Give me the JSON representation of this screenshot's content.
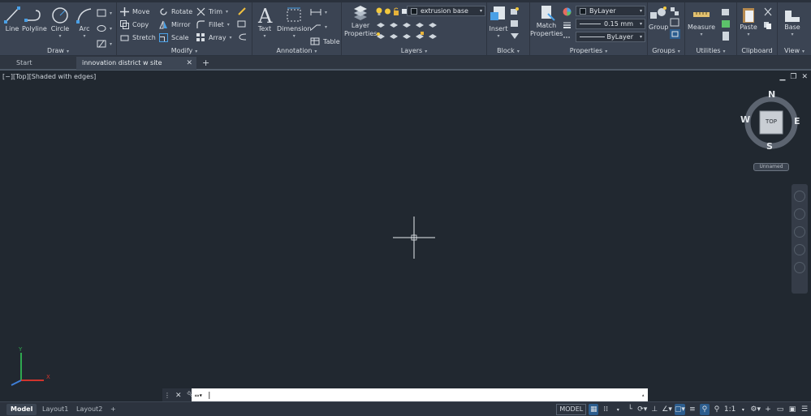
{
  "ribbon": {
    "draw": {
      "title": "Draw",
      "line": "Line",
      "polyline": "Polyline",
      "circle": "Circle",
      "arc": "Arc"
    },
    "modify": {
      "title": "Modify",
      "move": "Move",
      "rotate": "Rotate",
      "trim": "Trim",
      "copy": "Copy",
      "mirror": "Mirror",
      "fillet": "Fillet",
      "stretch": "Stretch",
      "scale": "Scale",
      "array": "Array"
    },
    "annotation": {
      "title": "Annotation",
      "text": "Text",
      "dimension": "Dimension",
      "table": "Table"
    },
    "layers": {
      "title": "Layers",
      "layer_properties": "Layer Properties",
      "current_layer": "extrusion base"
    },
    "block": {
      "title": "Block",
      "insert": "Insert"
    },
    "properties": {
      "title": "Properties",
      "match_properties": "Match Properties",
      "color": "ByLayer",
      "lineweight": "0.15 mm",
      "linetype": "ByLayer"
    },
    "groups": {
      "title": "Groups",
      "group": "Group"
    },
    "utilities": {
      "title": "Utilities",
      "measure": "Measure"
    },
    "clipboard": {
      "title": "Clipboard",
      "paste": "Paste"
    },
    "view": {
      "title": "View",
      "base": "Base"
    }
  },
  "filetabs": {
    "start": "Start",
    "document": "innovation district w site boundary*"
  },
  "viewport": {
    "label": "[−][Top][Shaded with edges]",
    "viewcube": {
      "face": "TOP",
      "n": "N",
      "s": "S",
      "e": "E",
      "w": "W",
      "ucs_name": "Unnamed"
    },
    "ucs": {
      "x": "X",
      "y": "Y"
    }
  },
  "commandline": {
    "value": ""
  },
  "statusbar": {
    "layouts": [
      "Model",
      "Layout1",
      "Layout2"
    ],
    "space": "MODEL",
    "annotation_scale": "1:1"
  },
  "colors": {
    "background": "#212830",
    "ribbon": "#3b4453",
    "accent": "#2c5d8e",
    "ucs_x": "#d0342c",
    "ucs_y": "#2fa84f"
  }
}
